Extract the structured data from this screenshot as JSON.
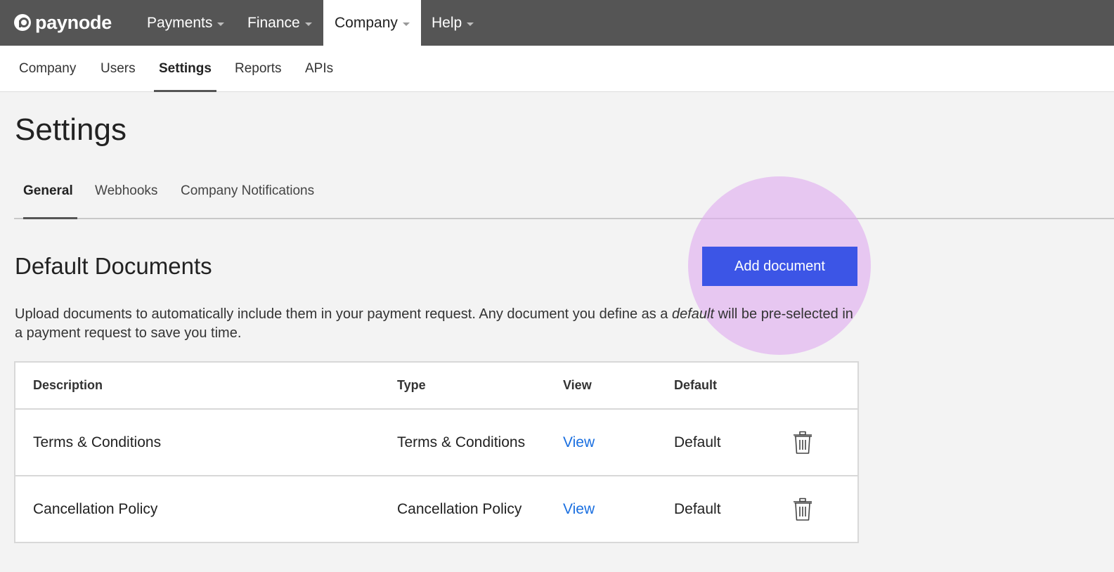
{
  "brand": {
    "name": "paynode"
  },
  "topnav": [
    {
      "label": "Payments",
      "active": false
    },
    {
      "label": "Finance",
      "active": false
    },
    {
      "label": "Company",
      "active": true
    },
    {
      "label": "Help",
      "active": false
    }
  ],
  "subnav": [
    {
      "label": "Company",
      "active": false
    },
    {
      "label": "Users",
      "active": false
    },
    {
      "label": "Settings",
      "active": true
    },
    {
      "label": "Reports",
      "active": false
    },
    {
      "label": "APIs",
      "active": false
    }
  ],
  "page": {
    "title": "Settings"
  },
  "tabs": [
    {
      "label": "General",
      "active": true
    },
    {
      "label": "Webhooks",
      "active": false
    },
    {
      "label": "Company Notifications",
      "active": false
    }
  ],
  "section": {
    "title": "Default Documents",
    "add_button": "Add document",
    "description_pre": "Upload documents to automatically include them in your payment request. Any document you define as a ",
    "description_em": "default",
    "description_post": " will be pre-selected in a payment request to save you time."
  },
  "table": {
    "headers": {
      "description": "Description",
      "type": "Type",
      "view": "View",
      "default": "Default"
    },
    "rows": [
      {
        "description": "Terms & Conditions",
        "type": "Terms & Conditions",
        "view": "View",
        "default": "Default",
        "action_icon": "trash-icon"
      },
      {
        "description": "Cancellation Policy",
        "type": "Cancellation Policy",
        "view": "View",
        "default": "Default",
        "action_icon": "trash-icon"
      }
    ]
  },
  "colors": {
    "topbar": "#555555",
    "accent_button": "#3c55e6",
    "link": "#1a6fe0",
    "highlight": "#e0aaf0",
    "page_background": "#f3f3f3"
  }
}
